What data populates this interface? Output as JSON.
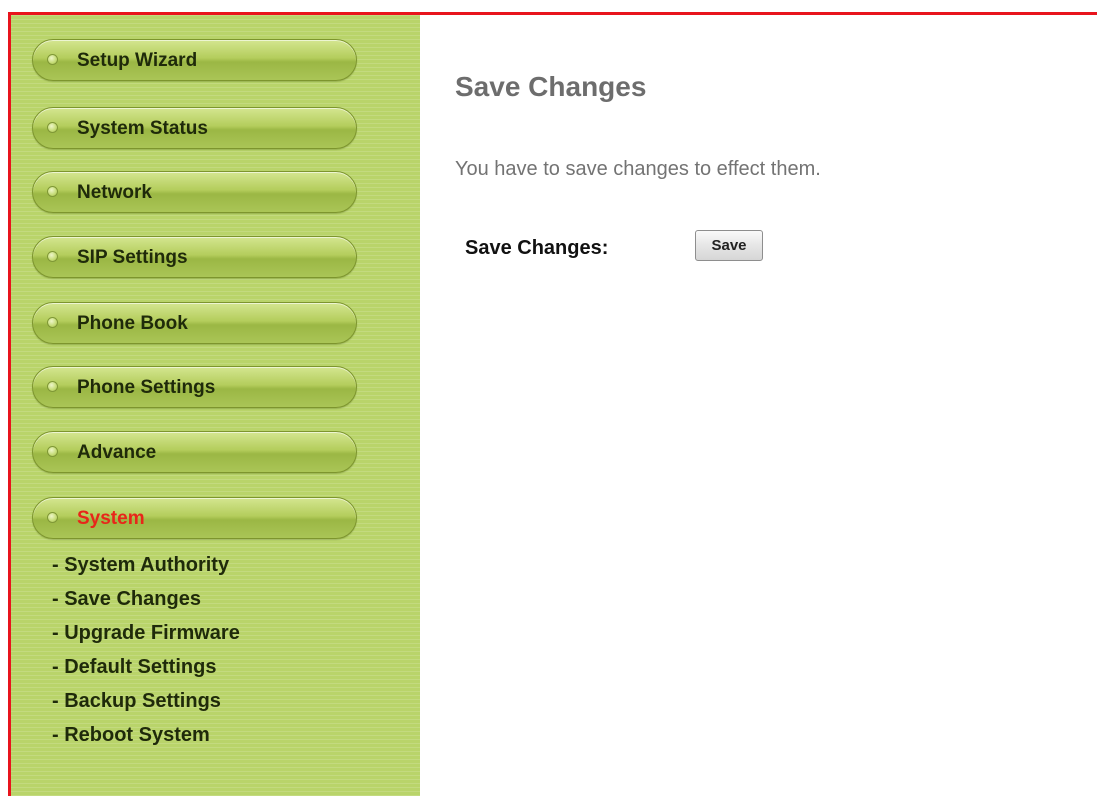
{
  "sidebar": {
    "menu": [
      {
        "label": "Setup Wizard",
        "active": false
      },
      {
        "label": "System Status",
        "active": false
      },
      {
        "label": "Network",
        "active": false
      },
      {
        "label": "SIP Settings",
        "active": false
      },
      {
        "label": "Phone Book",
        "active": false
      },
      {
        "label": "Phone Settings",
        "active": false
      },
      {
        "label": "Advance",
        "active": false
      },
      {
        "label": "System",
        "active": true
      }
    ],
    "submenu": [
      "- System Authority",
      "- Save Changes",
      "- Upgrade Firmware",
      "- Default Settings",
      "- Backup Settings",
      "- Reboot System"
    ]
  },
  "main": {
    "title": "Save Changes",
    "description": "You have to save changes to effect them.",
    "save_label": "Save Changes:",
    "save_button": "Save"
  },
  "colors": {
    "frame_border": "#e8141c",
    "sidebar_bg": "#b9d46a",
    "active_item": "#e8261a"
  }
}
